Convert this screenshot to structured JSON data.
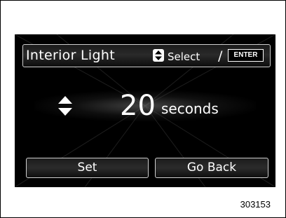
{
  "screen": {
    "title": "Interior Light",
    "hint": {
      "updown_icon": "up-down-arrows-icon",
      "select_label": "Select",
      "separator": "/",
      "enter_label": "ENTER"
    },
    "setting": {
      "adjust_icon": "up-down-arrows-icon",
      "value": "20",
      "unit": "seconds"
    },
    "buttons": {
      "set_label": "Set",
      "back_label": "Go Back"
    }
  },
  "figure_number": "303153",
  "colors": {
    "screen_background": "#000000",
    "text": "#ffffff",
    "button_border": "#cfcfcf"
  }
}
